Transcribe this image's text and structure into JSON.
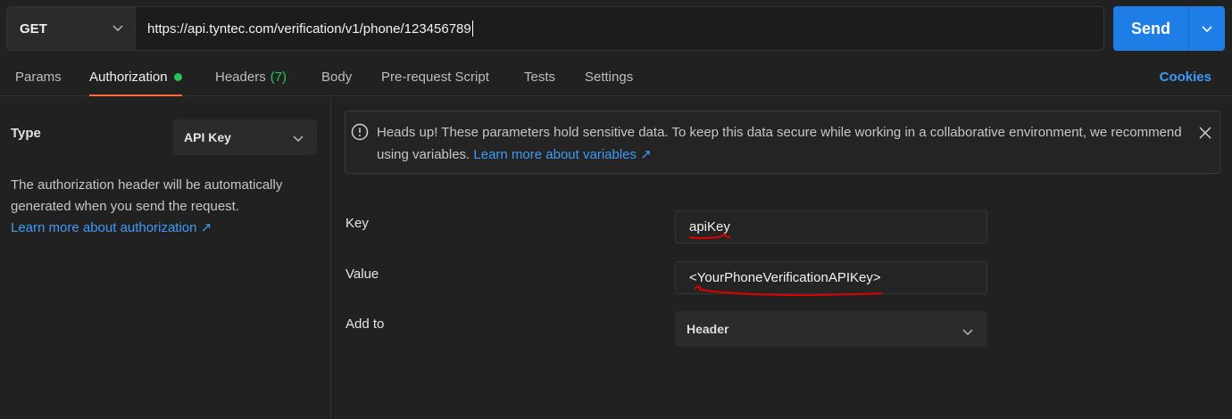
{
  "request": {
    "method": "GET",
    "url": "https://api.tyntec.com/verification/v1/phone/123456789",
    "send_label": "Send"
  },
  "tabs": [
    {
      "label": "Params"
    },
    {
      "label": "Authorization"
    },
    {
      "label": "Headers",
      "count": "(7)"
    },
    {
      "label": "Body"
    },
    {
      "label": "Pre-request Script"
    },
    {
      "label": "Tests"
    },
    {
      "label": "Settings"
    }
  ],
  "cookies_label": "Cookies",
  "auth": {
    "type_label": "Type",
    "type_value": "API Key",
    "description": "The authorization header will be automatically generated when you send the request.",
    "learn_more": "Learn more about authorization ↗"
  },
  "notice": {
    "text": "Heads up! These parameters hold sensitive data. To keep this data secure while working in a collaborative environment, we recommend using variables.",
    "link": "Learn more about variables ↗"
  },
  "fields": {
    "key_label": "Key",
    "key_value": "apiKey",
    "value_label": "Value",
    "value_value": "<YourPhoneVerificationAPIKey>",
    "addto_label": "Add to",
    "addto_value": "Header"
  },
  "colors": {
    "accent": "#ff6c37",
    "send": "#1f7ee6",
    "link": "#3d9bf5",
    "status_green": "#29c35c",
    "annotation_red": "#e00000"
  }
}
